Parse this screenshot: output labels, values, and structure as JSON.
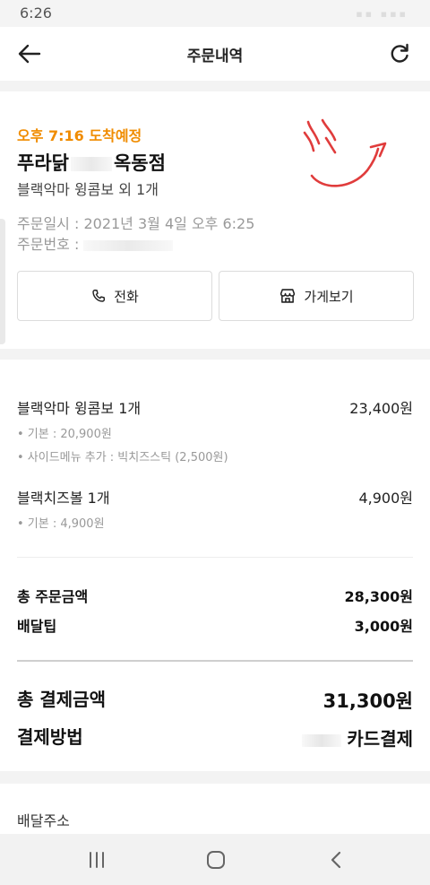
{
  "status_bar": {
    "time": "6:26"
  },
  "header": {
    "title": "주문내역"
  },
  "order": {
    "arrival": "오후 7:16 도착예정",
    "store_name_prefix": "푸라닭",
    "store_name_suffix": "옥동점",
    "menu_summary": "블랙악마 윙콤보 외 1개",
    "order_date_label": "주문일시 : ",
    "order_date_value": "2021년 3월 4일 오후 6:25",
    "order_number_label": "주문번호 : "
  },
  "actions": {
    "call_label": "전화",
    "store_label": "가게보기"
  },
  "items": [
    {
      "name": "블랙악마 윙콤보 1개",
      "price": "23,400원",
      "options": [
        "• 기본 : 20,900원",
        "• 사이드메뉴 추가 : 빅치즈스틱 (2,500원)"
      ]
    },
    {
      "name": "블랙치즈볼 1개",
      "price": "4,900원",
      "options": [
        "• 기본 : 4,900원"
      ]
    }
  ],
  "summary": {
    "order_total_label": "총 주문금액",
    "order_total_value": "28,300원",
    "delivery_tip_label": "배달팁",
    "delivery_tip_value": "3,000원",
    "payment_total_label": "총 결제금액",
    "payment_total_value": "31,300원",
    "payment_method_label": "결제방법",
    "payment_method_value": "카드결제"
  },
  "address": {
    "label": "배달주소"
  },
  "colors": {
    "accent": "#f08c00",
    "scribble": "#e03c3c"
  },
  "icons": {
    "back": "arrow-left-icon",
    "refresh": "refresh-icon",
    "call": "phone-icon",
    "store": "store-icon",
    "nav_recent": "recent-apps-icon",
    "nav_home": "home-icon",
    "nav_back": "back-chevron-icon"
  }
}
